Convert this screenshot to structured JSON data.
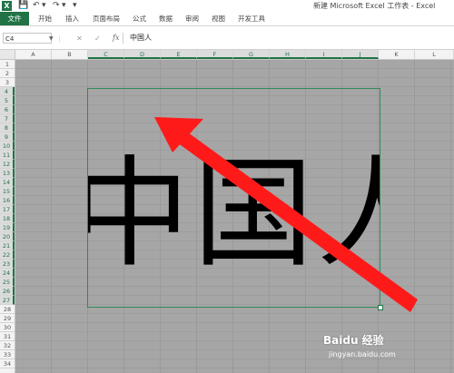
{
  "app": {
    "title": "新建 Microsoft Excel 工作表 - Excel",
    "logo_letter": "X",
    "accent_color": "#217346"
  },
  "qat": {
    "save_icon": "save-icon",
    "undo_icon": "undo-icon",
    "redo_icon": "redo-icon",
    "customize_icon": "chevron-down-icon"
  },
  "ribbon_tabs": [
    {
      "label": "文件"
    },
    {
      "label": "开始"
    },
    {
      "label": "插入"
    },
    {
      "label": "页面布局"
    },
    {
      "label": "公式"
    },
    {
      "label": "数据"
    },
    {
      "label": "审阅"
    },
    {
      "label": "视图"
    },
    {
      "label": "开发工具"
    }
  ],
  "formula_bar": {
    "name_box": "C4",
    "cancel": "✕",
    "enter": "✓",
    "fx": "fx",
    "content": "中国人"
  },
  "columns": [
    "A",
    "B",
    "C",
    "D",
    "E",
    "F",
    "G",
    "H",
    "I",
    "J",
    "K",
    "L"
  ],
  "selected_columns": [
    "C",
    "D",
    "E",
    "F",
    "G",
    "H",
    "I",
    "J"
  ],
  "rows": [
    "1",
    "2",
    "3",
    "4",
    "5",
    "6",
    "7",
    "8",
    "9",
    "10",
    "11",
    "12",
    "13",
    "14",
    "15",
    "16",
    "17",
    "18",
    "19",
    "20",
    "21",
    "22",
    "23",
    "24",
    "25",
    "26",
    "27",
    "28",
    "29",
    "30",
    "31",
    "32",
    "33",
    "34"
  ],
  "selected_rows": [
    "4",
    "5",
    "6",
    "7",
    "8",
    "9",
    "10",
    "11",
    "12",
    "13",
    "14",
    "15",
    "16",
    "17",
    "18",
    "19",
    "20",
    "21",
    "22",
    "23",
    "24",
    "25",
    "26",
    "27"
  ],
  "picture": {
    "text": "中国人",
    "arrow_color": "#ff1a1a"
  },
  "watermark": {
    "text": "Baidu 经验",
    "url": "jingyan.baidu.com"
  }
}
